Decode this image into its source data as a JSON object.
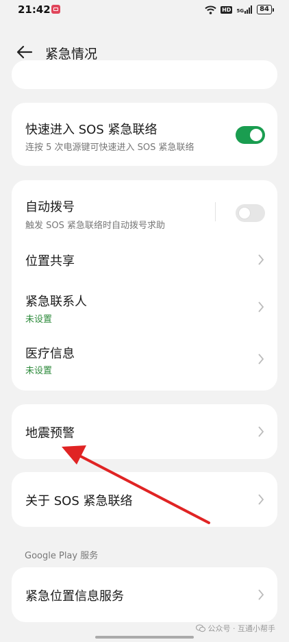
{
  "status_bar": {
    "time": "21:42",
    "hd": "HD",
    "signal_label": "5G",
    "battery": "84"
  },
  "header": {
    "title": "紧急情况"
  },
  "quick_sos": {
    "title": "快速进入 SOS 紧急联络",
    "subtitle": "连按 5 次电源键可快速进入 SOS 紧急联络",
    "toggle_on": true
  },
  "emergency_group": {
    "auto_dial": {
      "title": "自动拨号",
      "subtitle": "触发 SOS 紧急联络时自动拨号求助",
      "toggle_on": false
    },
    "location_share": {
      "title": "位置共享"
    },
    "contacts": {
      "title": "紧急联系人",
      "status": "未设置"
    },
    "medical": {
      "title": "医疗信息",
      "status": "未设置"
    }
  },
  "earthquake": {
    "title": "地震预警"
  },
  "about_sos": {
    "title": "关于 SOS 紧急联络"
  },
  "google_play": {
    "section_label": "Google Play 服务",
    "emergency_location": {
      "title": "紧急位置信息服务"
    }
  },
  "watermark": {
    "text": "公众号 · 互通小帮手"
  },
  "colors": {
    "toggle_on": "#1a9d50",
    "status_green": "#2e8b3c",
    "arrow_red": "#e02424",
    "background": "#f2f2f2"
  }
}
